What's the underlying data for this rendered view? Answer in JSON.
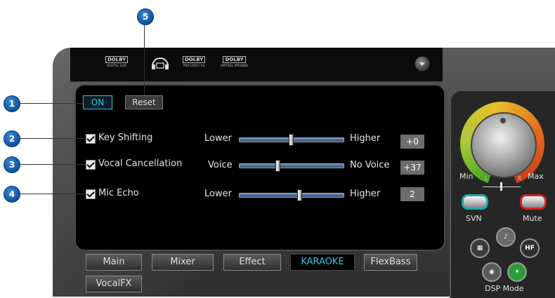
{
  "header": {
    "logos": [
      {
        "name": "DOLBY",
        "sub": "DIGITAL LIVE"
      },
      {
        "name": "DOLBY",
        "sub": "PRO LOGIC IIx"
      },
      {
        "name": "DOLBY",
        "sub": "VIRTUAL SPEAKER"
      }
    ]
  },
  "controls": {
    "on_label": "ON",
    "reset_label": "Reset"
  },
  "rows": [
    {
      "label": "Key Shifting",
      "left": "Lower",
      "right": "Higher",
      "value": "+0",
      "checked": true,
      "level": 0.5
    },
    {
      "label": "Vocal Cancellation",
      "left": "Voice",
      "right": "No Voice",
      "value": "+37",
      "checked": true,
      "level": 0.37
    },
    {
      "label": "Mic Echo",
      "left": "Lower",
      "right": "Higher",
      "value": "2",
      "checked": true,
      "level": 0.58
    }
  ],
  "tabs": [
    {
      "label": "Main"
    },
    {
      "label": "Mixer"
    },
    {
      "label": "Effect"
    },
    {
      "label": "KARAOKE",
      "active": true
    },
    {
      "label": "FlexBass"
    },
    {
      "label": "VocalFX"
    }
  ],
  "right": {
    "min": "Min",
    "max": "Max",
    "balance_l": "L",
    "balance_r": "R",
    "svn": "SVN",
    "mute": "Mute",
    "dsp": "DSP Mode",
    "hf": "HF"
  },
  "callouts": [
    "1",
    "2",
    "3",
    "4",
    "5"
  ],
  "colors": {
    "accent": "#2ec8e8",
    "callout": "#1a66c2",
    "svn": "#1fa9a9",
    "mute": "#d42222"
  }
}
